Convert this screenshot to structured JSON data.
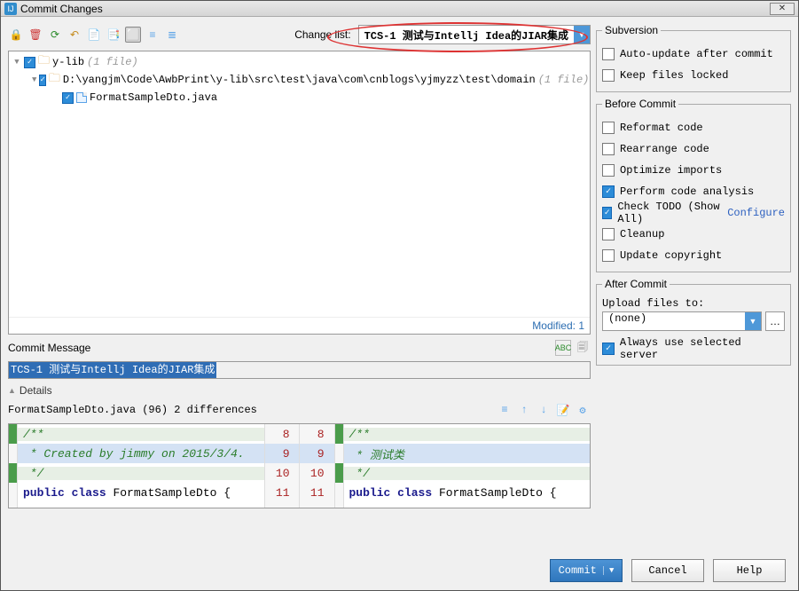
{
  "window": {
    "title": "Commit Changes"
  },
  "toolbar": {
    "change_list_label": "Change list:",
    "change_list_value": "TCS-1 测试与Intellj Idea的JIAR集成"
  },
  "tree": {
    "root": {
      "label": "y-lib",
      "count": "(1 file)"
    },
    "path": {
      "label": "D:\\yangjm\\Code\\AwbPrint\\y-lib\\src\\test\\java\\com\\cnblogs\\yjmyzz\\test\\domain",
      "count": "(1 file)"
    },
    "file": {
      "label": "FormatSampleDto.java"
    },
    "footer": "Modified: 1"
  },
  "commit_message": {
    "section_label": "Commit Message",
    "value": "TCS-1 测试与Intellj Idea的JIAR集成"
  },
  "details": {
    "label": "Details",
    "file_line": "FormatSampleDto.java (96) 2 differences"
  },
  "diff": {
    "left": [
      {
        "ln": "8",
        "code": "/**",
        "cls": "green"
      },
      {
        "ln": "9",
        "code": " * Created by jimmy on 2015/3/4.",
        "cls": "greenmod"
      },
      {
        "ln": "10",
        "code": " */",
        "cls": "green"
      },
      {
        "ln": "11",
        "code_html": "<span class='kw'>public</span> <span class='kw'>class</span> FormatSampleDto {"
      }
    ],
    "right": [
      {
        "ln": "8",
        "code": "/**",
        "cls": "green"
      },
      {
        "ln": "9",
        "code": " * 测试类",
        "cls": "greenmod"
      },
      {
        "ln": "10",
        "code": " */",
        "cls": "green"
      },
      {
        "ln": "11",
        "code_html": "<span class='kw'>public</span> <span class='kw'>class</span> FormatSampleDto {"
      }
    ]
  },
  "subversion": {
    "legend": "Subversion",
    "auto_update": "Auto-update after commit",
    "keep_locked": "Keep files locked"
  },
  "before_commit": {
    "legend": "Before Commit",
    "reformat": "Reformat code",
    "rearrange": "Rearrange code",
    "optimize": "Optimize imports",
    "analysis": "Perform code analysis",
    "todo": "Check TODO (Show All)",
    "todo_configure": "Configure",
    "cleanup": "Cleanup",
    "copyright": "Update copyright"
  },
  "after_commit": {
    "legend": "After Commit",
    "upload_label": "Upload files to:",
    "upload_value": "(none)",
    "always_server": "Always use selected server"
  },
  "buttons": {
    "commit": "Commit",
    "cancel": "Cancel",
    "help": "Help"
  }
}
